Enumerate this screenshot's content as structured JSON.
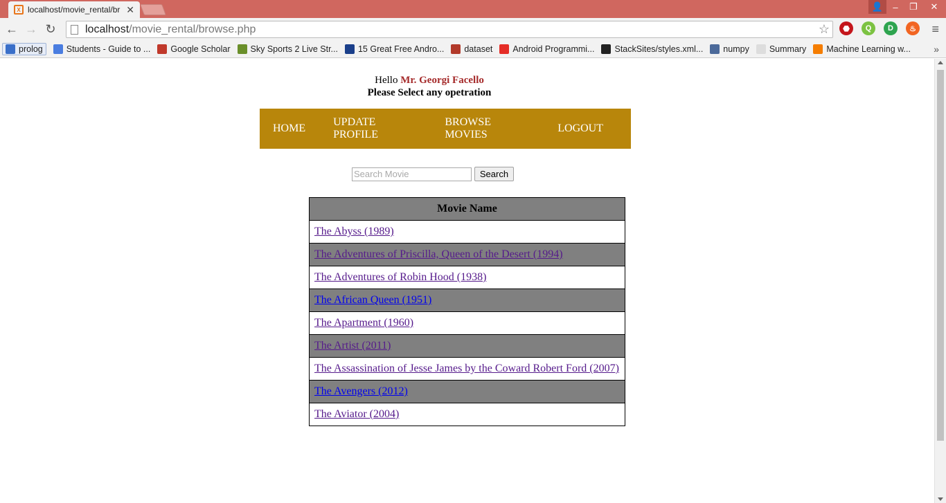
{
  "browser": {
    "tab_title": "localhost/movie_rental/br",
    "url_host": "localhost",
    "url_path": "/movie_rental/browse.php",
    "bookmarks": [
      {
        "label": "prolog",
        "icon": "gear-icon",
        "color": "#3a6fc9"
      },
      {
        "label": "Students - Guide to ...",
        "icon": "google-icon",
        "color": "#4a7de0"
      },
      {
        "label": "Google Scholar",
        "icon": "scholar-icon",
        "color": "#c0392b"
      },
      {
        "label": "Sky Sports 2 Live Str...",
        "icon": "leaf-icon",
        "color": "#6a8f2a"
      },
      {
        "label": "15 Great Free Andro...",
        "icon": "efy-icon",
        "color": "#1a3f8a"
      },
      {
        "label": "dataset",
        "icon": "q-icon",
        "color": "#b23a2a"
      },
      {
        "label": "Android Programmi...",
        "icon": "youtube-icon",
        "color": "#e52d27"
      },
      {
        "label": "StackSites/styles.xml...",
        "icon": "github-icon",
        "color": "#222222"
      },
      {
        "label": "numpy",
        "icon": "numpy-icon",
        "color": "#4c6a9a"
      },
      {
        "label": "Summary",
        "icon": "page-icon",
        "color": "#dddddd"
      },
      {
        "label": "Machine Learning w...",
        "icon": "blogger-icon",
        "color": "#f57d00"
      }
    ]
  },
  "header": {
    "hello": "Hello",
    "user_name": "Mr. Georgi Facello",
    "prompt": "Please Select any opetration"
  },
  "nav": [
    {
      "label": "HOME"
    },
    {
      "label": "UPDATE PROFILE"
    },
    {
      "label": "BROWSE MOVIES"
    },
    {
      "label": "LOGOUT"
    }
  ],
  "search": {
    "placeholder": "Search Movie",
    "button_label": "Search"
  },
  "table": {
    "header": "Movie Name",
    "rows": [
      {
        "title": "The Abyss (1989)",
        "visited": true
      },
      {
        "title": "The Adventures of Priscilla, Queen of the Desert (1994)",
        "visited": true
      },
      {
        "title": "The Adventures of Robin Hood (1938)",
        "visited": true
      },
      {
        "title": "The African Queen (1951)",
        "visited": false
      },
      {
        "title": "The Apartment (1960)",
        "visited": true
      },
      {
        "title": "The Artist (2011)",
        "visited": true
      },
      {
        "title": "The Assassination of Jesse James by the Coward Robert Ford (2007)",
        "visited": true
      },
      {
        "title": "The Avengers (2012)",
        "visited": false
      },
      {
        "title": "The Aviator (2004)",
        "visited": true
      }
    ]
  },
  "colors": {
    "nav_bg": "#b8860b",
    "user_name": "#a52a2a",
    "row_alt": "#808080",
    "titlebar": "#d0675f"
  }
}
